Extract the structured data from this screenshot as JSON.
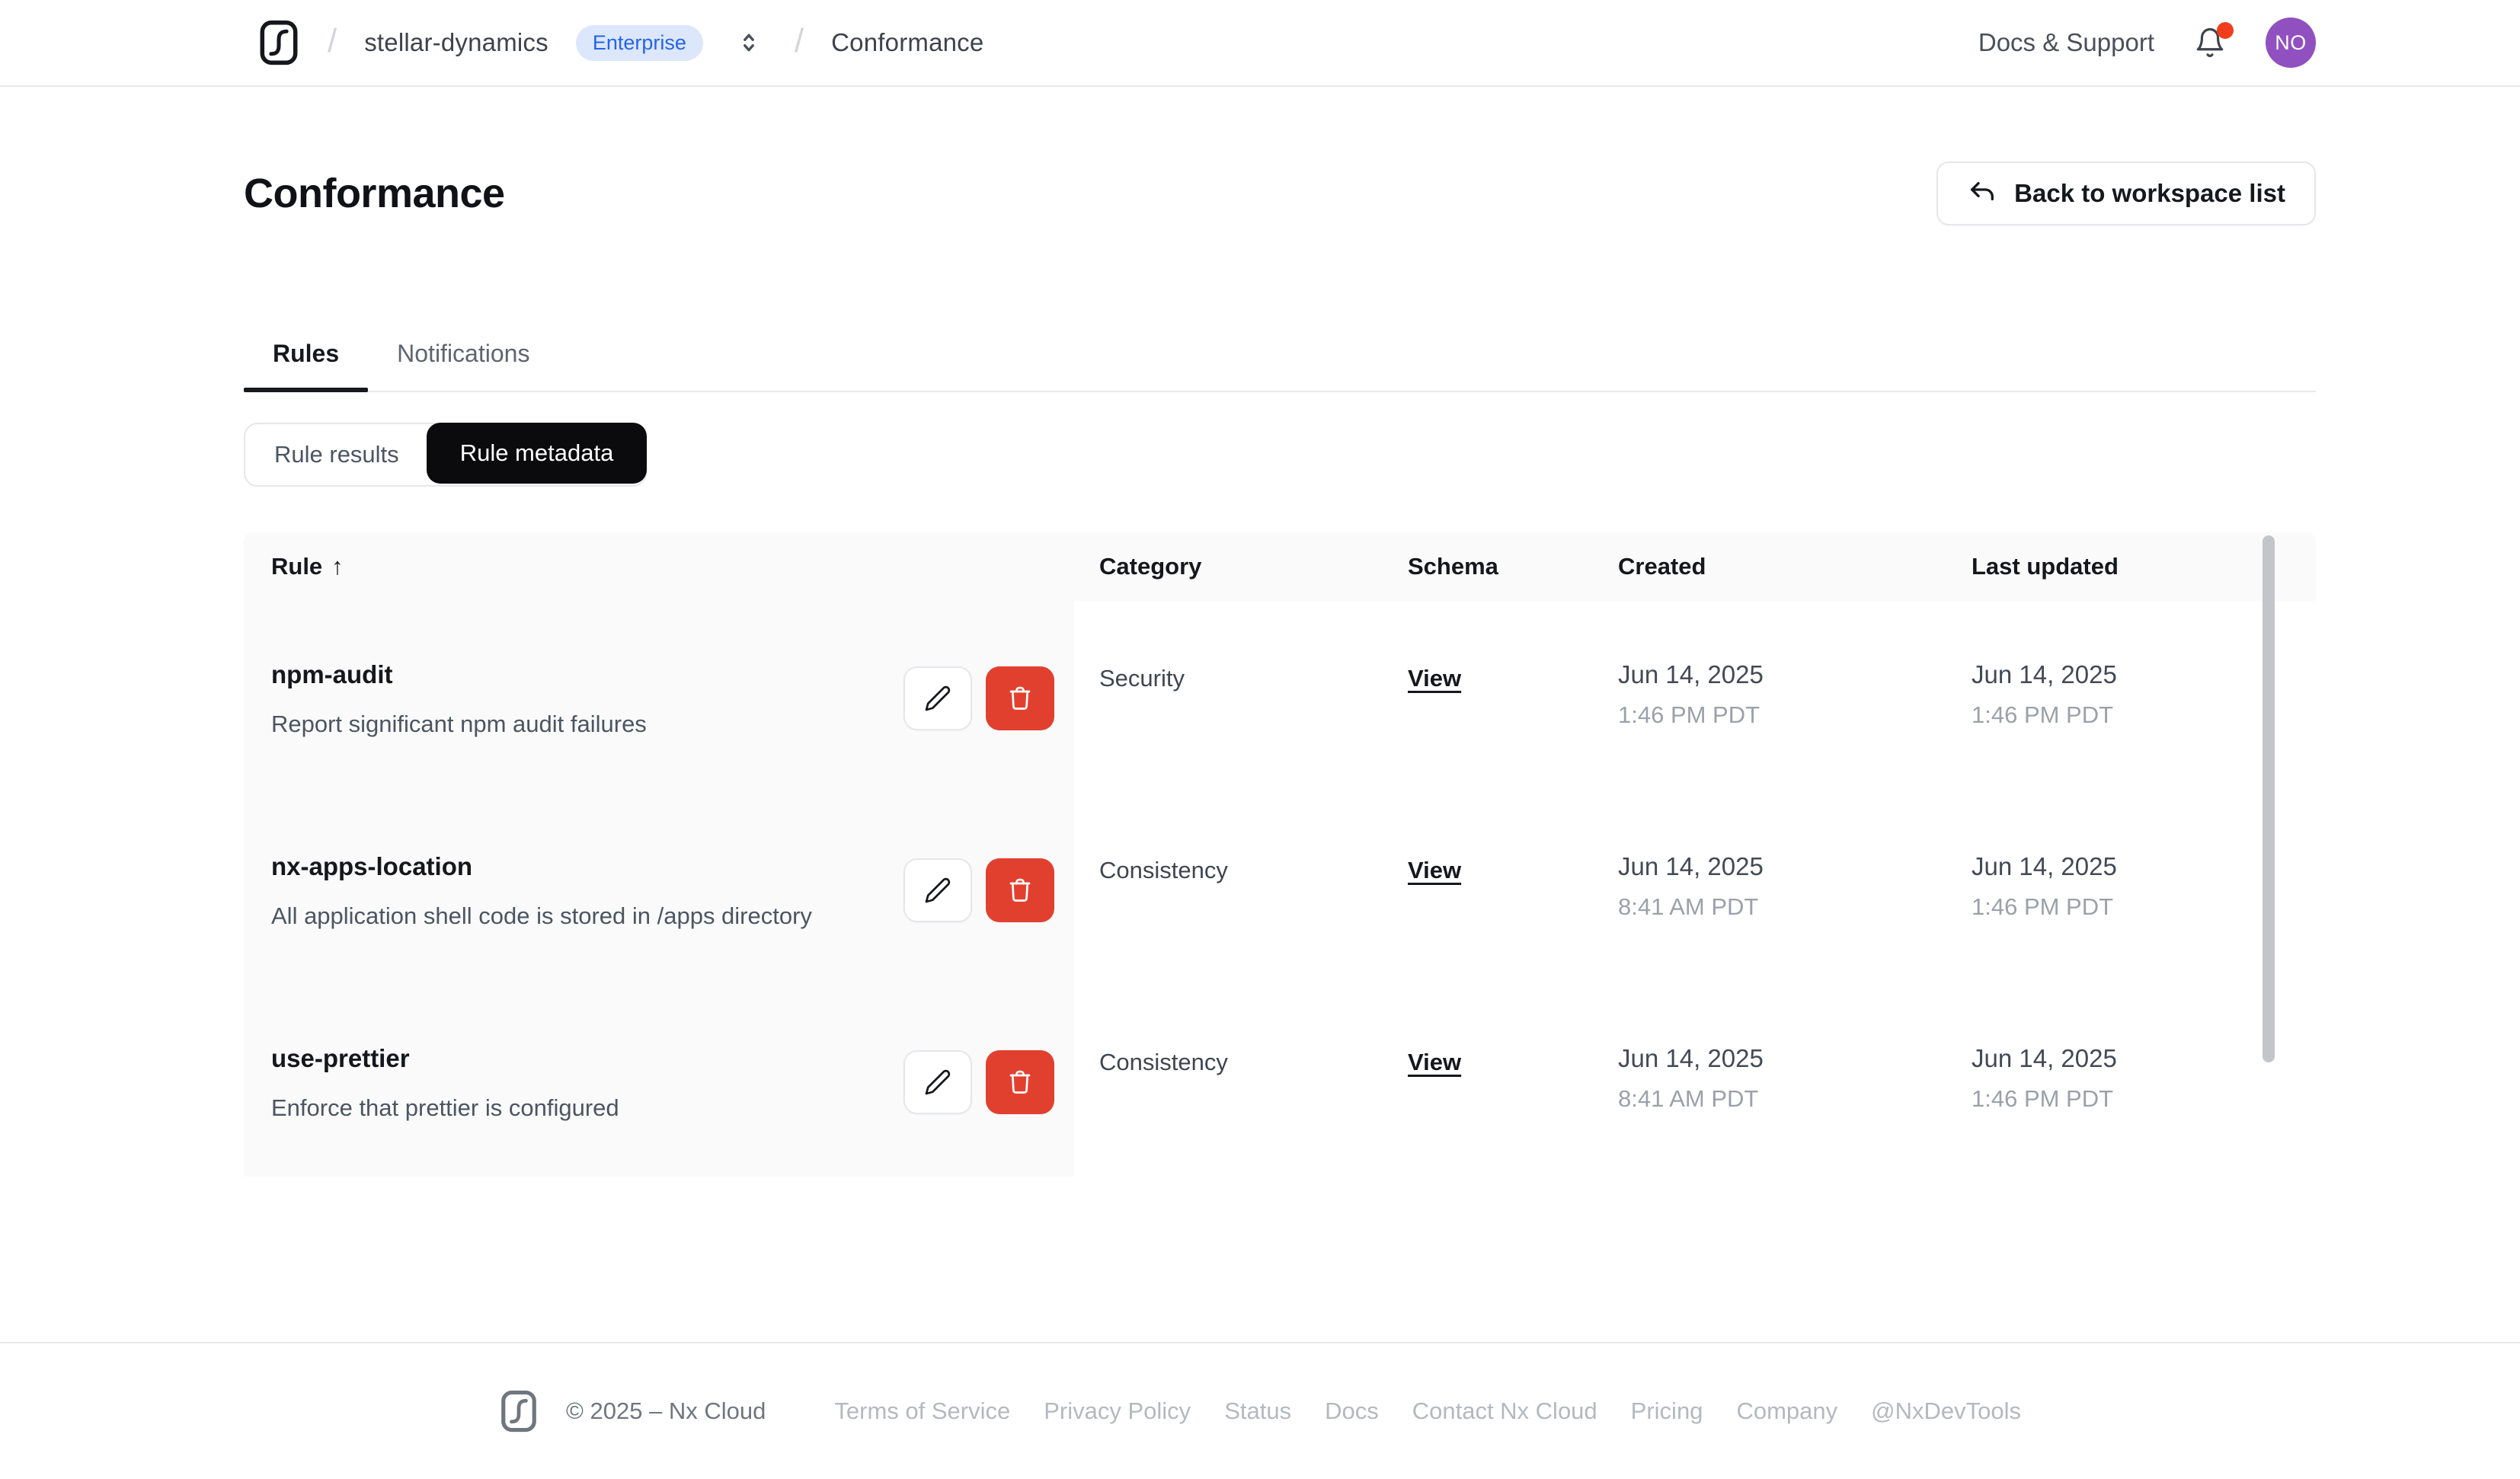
{
  "nav": {
    "breadcrumb": {
      "workspace": "stellar-dynamics",
      "plan_badge": "Enterprise",
      "page": "Conformance"
    },
    "docs_support_label": "Docs & Support",
    "avatar_initials": "NO"
  },
  "page": {
    "title": "Conformance",
    "back_button_label": "Back to workspace list"
  },
  "tabs": [
    {
      "label": "Rules",
      "active": true
    },
    {
      "label": "Notifications",
      "active": false
    }
  ],
  "segmented": [
    {
      "label": "Rule results",
      "active": false
    },
    {
      "label": "Rule metadata",
      "active": true
    }
  ],
  "table": {
    "columns": {
      "rule": "Rule",
      "sort_indicator": "↑",
      "category": "Category",
      "schema": "Schema",
      "created": "Created",
      "updated": "Last updated"
    },
    "rows": [
      {
        "name": "npm-audit",
        "description": "Report significant npm audit failures",
        "category": "Security",
        "schema_link": "View",
        "created_date": "Jun 14, 2025",
        "created_time": "1:46 PM PDT",
        "updated_date": "Jun 14, 2025",
        "updated_time": "1:46 PM PDT"
      },
      {
        "name": "nx-apps-location",
        "description": "All application shell code is stored in /apps directory",
        "category": "Consistency",
        "schema_link": "View",
        "created_date": "Jun 14, 2025",
        "created_time": "8:41 AM PDT",
        "updated_date": "Jun 14, 2025",
        "updated_time": "1:46 PM PDT"
      },
      {
        "name": "use-prettier",
        "description": "Enforce that prettier is configured",
        "category": "Consistency",
        "schema_link": "View",
        "created_date": "Jun 14, 2025",
        "created_time": "8:41 AM PDT",
        "updated_date": "Jun 14, 2025",
        "updated_time": "1:46 PM PDT"
      }
    ]
  },
  "footer": {
    "copyright": "© 2025 – Nx Cloud",
    "links": [
      "Terms of Service",
      "Privacy Policy",
      "Status",
      "Docs",
      "Contact Nx Cloud",
      "Pricing",
      "Company",
      "@NxDevTools"
    ]
  },
  "icons": {
    "nx_logo": "rounded-square-with-curve",
    "back": "undo-arrow",
    "workspace_switcher": "chevrons-up-down",
    "notifications": "bell-with-red-dot",
    "edit": "pencil",
    "delete": "trash-can",
    "sort": "↑"
  },
  "colors": {
    "delete_red": "#e2402f",
    "badge_blue_text": "#2563eb",
    "badge_blue_bg": "#dce7fb",
    "avatar_purple": "#9150c0",
    "active_pill_black": "#0b0b0e",
    "notification_dot_red": "#f03e1d",
    "rule_column_bg": "#fafafa",
    "border_gray": "#e5e7eb"
  }
}
